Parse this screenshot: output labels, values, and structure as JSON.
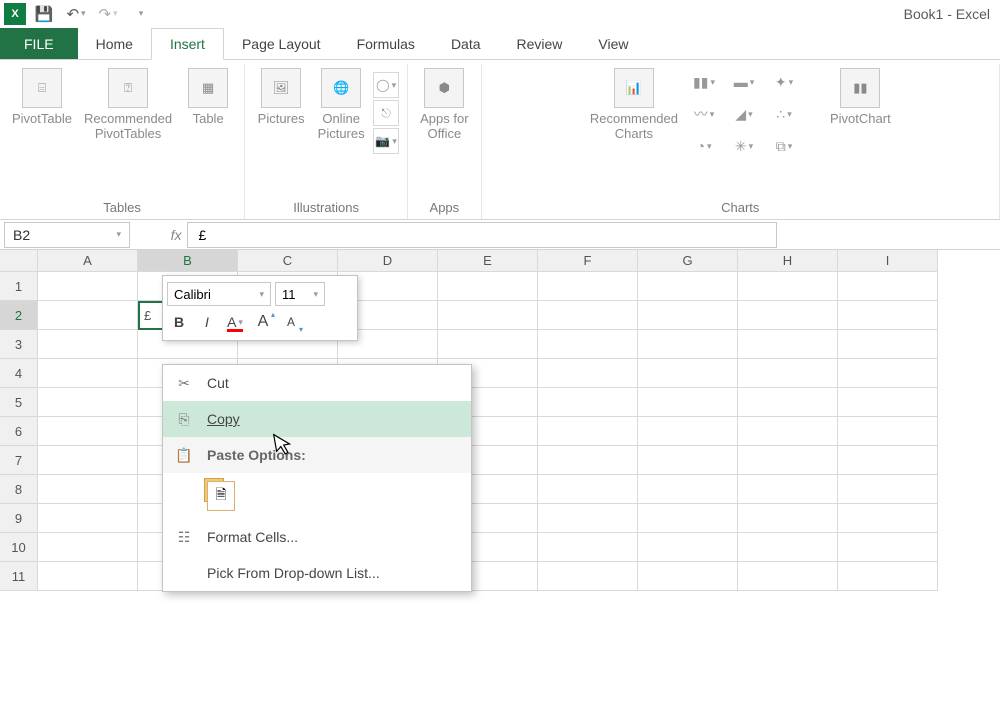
{
  "titlebar": {
    "title": "Book1 - Excel"
  },
  "tabs": {
    "file": "FILE",
    "items": [
      "Home",
      "Insert",
      "Page Layout",
      "Formulas",
      "Data",
      "Review",
      "View"
    ],
    "active": "Insert"
  },
  "ribbon": {
    "groups": {
      "tables": {
        "label": "Tables",
        "pivottable": "PivotTable",
        "recommended": "Recommended\nPivotTables",
        "table": "Table"
      },
      "illustrations": {
        "label": "Illustrations",
        "pictures": "Pictures",
        "online": "Online\nPictures"
      },
      "apps": {
        "label": "Apps",
        "appsfor": "Apps for\nOffice"
      },
      "charts": {
        "label": "Charts",
        "recommended": "Recommended\nCharts",
        "pivotchart": "PivotChart"
      }
    }
  },
  "namebox": {
    "value": "B2"
  },
  "formula": {
    "value": "£"
  },
  "grid": {
    "cols": [
      "A",
      "B",
      "C",
      "D",
      "E",
      "F",
      "G",
      "H",
      "I"
    ],
    "row_count": 11,
    "active_row": 2,
    "active_col": "B",
    "cell_B2": "£"
  },
  "mini_toolbar": {
    "font": "Calibri",
    "size": "11"
  },
  "context_menu": {
    "cut": "Cut",
    "copy": "Copy",
    "paste_options": "Paste Options:",
    "format_cells": "Format Cells...",
    "pick_list": "Pick From Drop-down List..."
  }
}
